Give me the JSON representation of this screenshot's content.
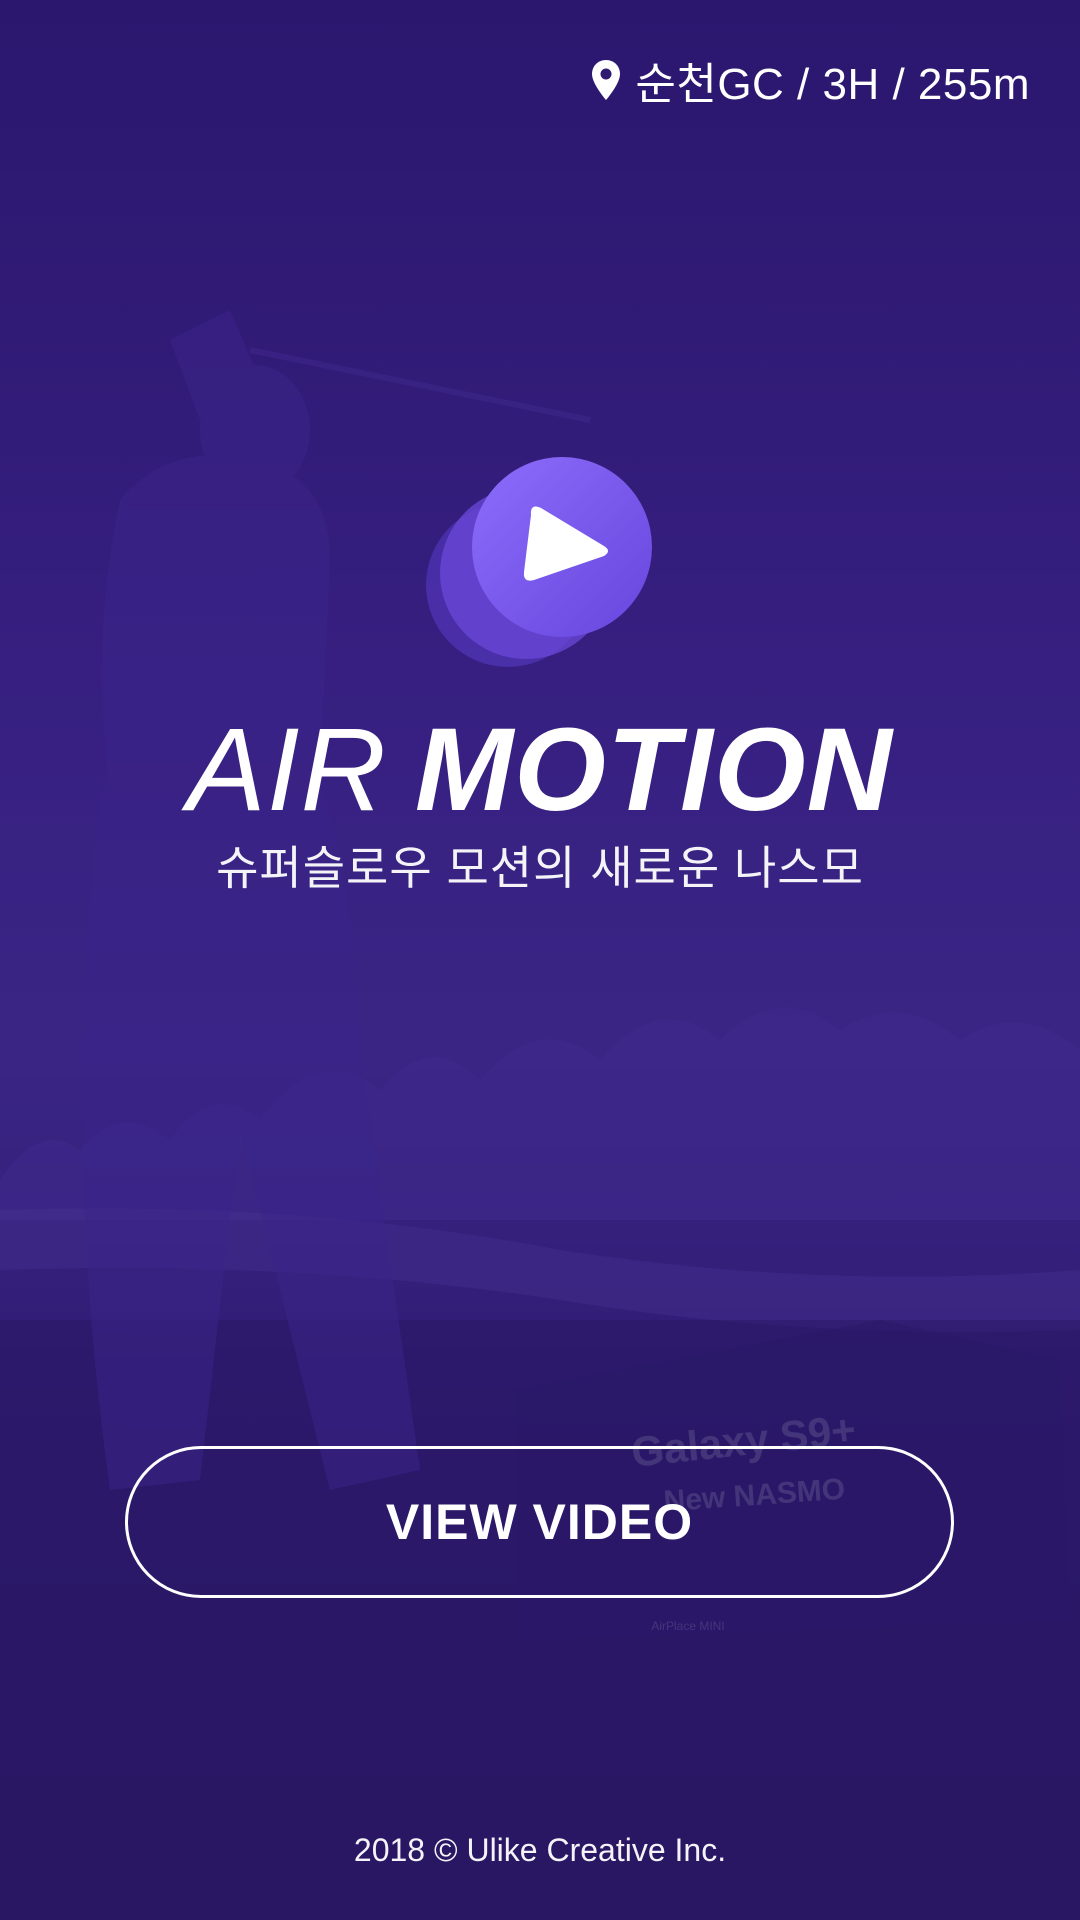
{
  "location": {
    "icon": "location-pin-icon",
    "text": "순천GC / 3H / 255m"
  },
  "brand": {
    "logo_icon": "play-icon",
    "title_light": "AIR",
    "title_bold": "MOTION",
    "subtitle": "슈퍼슬로우 모션의 새로운 나스모"
  },
  "cta": {
    "label": "VIEW VIDEO"
  },
  "background_print": {
    "line1": "Galaxy S9+",
    "line2": "New NASMO",
    "line3": "AirPlace MINI"
  },
  "footer": {
    "copyright": "2018 © Ulike Creative Inc."
  },
  "colors": {
    "background": "#2b176e",
    "accent": "#8a6cff",
    "text": "#ffffff"
  }
}
